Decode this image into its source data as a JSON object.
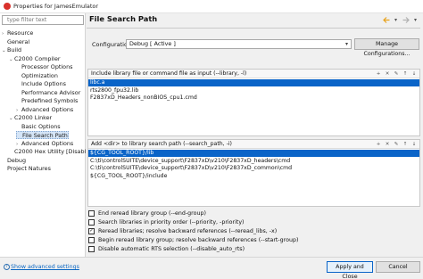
{
  "window": {
    "title": "Properties for JamesEmulator"
  },
  "sidebar": {
    "filter_placeholder": "type filter text",
    "items": [
      {
        "label": "Resource",
        "twisty": ">",
        "indent": 0
      },
      {
        "label": "General",
        "twisty": "",
        "indent": 0
      },
      {
        "label": "Build",
        "twisty": "v",
        "indent": 0
      },
      {
        "label": "C2000 Compiler",
        "twisty": "v",
        "indent": 1
      },
      {
        "label": "Processor Options",
        "twisty": "",
        "indent": 2
      },
      {
        "label": "Optimization",
        "twisty": "",
        "indent": 2
      },
      {
        "label": "Include Options",
        "twisty": "",
        "indent": 2
      },
      {
        "label": "Performance Advisor",
        "twisty": "",
        "indent": 2
      },
      {
        "label": "Predefined Symbols",
        "twisty": "",
        "indent": 2
      },
      {
        "label": "Advanced Options",
        "twisty": ">",
        "indent": 2
      },
      {
        "label": "C2000 Linker",
        "twisty": "v",
        "indent": 1
      },
      {
        "label": "Basic Options",
        "twisty": "",
        "indent": 2
      },
      {
        "label": "File Search Path",
        "twisty": "",
        "indent": 2,
        "selected": true
      },
      {
        "label": "Advanced Options",
        "twisty": ">",
        "indent": 2
      },
      {
        "label": "C2000 Hex Utility  [Disabl",
        "twisty": "",
        "indent": 1
      },
      {
        "label": "Debug",
        "twisty": "",
        "indent": 0
      },
      {
        "label": "Project Natures",
        "twisty": "",
        "indent": 0
      }
    ]
  },
  "page": {
    "title": "File Search Path",
    "configuration_label": "Configuration:",
    "configuration_value": "Debug  [ Active ]",
    "manage_button": "Manage Configurations...",
    "library_group": {
      "header": "Include library file or command file as input (--library, -l)",
      "rows": [
        "libc.a",
        "rts2800_fpu32.lib",
        "F2837xD_Headers_nonBIOS_cpu1.cmd"
      ]
    },
    "search_group": {
      "header": "Add <dir> to library search path (--search_path, -i)",
      "rows": [
        "${CG_TOOL_ROOT}/lib",
        "C:\\ti\\controlSUITE\\device_support\\F2837xD\\v210\\F2837xD_headers\\cmd",
        "C:\\ti\\controlSUITE\\device_support\\F2837xD\\v210\\F2837xD_common\\cmd",
        "${CG_TOOL_ROOT}/include"
      ]
    },
    "checkboxes": [
      {
        "label": "End reread library group (--end-group)",
        "checked": false
      },
      {
        "label": "Search libraries in priority order (--priority, -priority)",
        "checked": false
      },
      {
        "label": "Reread libraries; resolve backward references (--reread_libs, -x)",
        "checked": true
      },
      {
        "label": "Begin reread library group; resolve backward references (--start-group)",
        "checked": false
      },
      {
        "label": "Disable automatic RTS selection (--disable_auto_rts)",
        "checked": false
      }
    ]
  },
  "footer": {
    "show_advanced": "Show advanced settings",
    "apply_close": "Apply and Close",
    "cancel": "Cancel"
  },
  "colors": {
    "selection": "#0a64c8",
    "link": "#0a66c2",
    "app_icon": "#d9312b"
  }
}
